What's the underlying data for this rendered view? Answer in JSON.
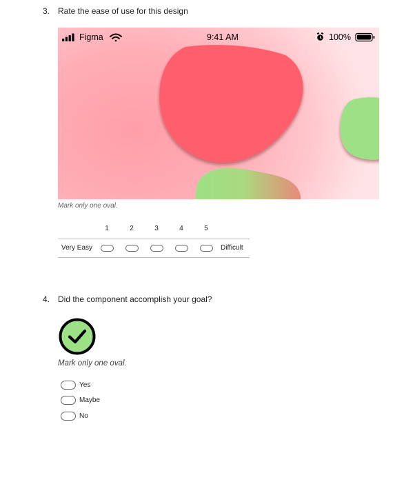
{
  "question3": {
    "number": "3.",
    "title": "Rate the ease of use for this design",
    "image": {
      "status_bar": {
        "carrier": "Figma",
        "time": "9:41 AM",
        "battery": "100%",
        "icons": [
          "signal-bars-icon",
          "wifi-icon",
          "alarm-icon",
          "battery-icon"
        ]
      },
      "colors": {
        "background": "#ffb3ba",
        "red_blob": "#ff5f6d",
        "green_blob": "#9ee085"
      }
    },
    "hint": "Mark only one oval.",
    "scale": {
      "numbers": [
        "1",
        "2",
        "3",
        "4",
        "5"
      ],
      "low_label": "Very Easy",
      "high_label": "Difficult"
    }
  },
  "question4": {
    "number": "4.",
    "title": "Did the component accomplish your goal?",
    "icon": {
      "name": "check-circle-icon",
      "fill": "#9ee085",
      "stroke": "#000000"
    },
    "hint": "Mark only one oval.",
    "options": [
      "Yes",
      "Maybe",
      "No"
    ]
  }
}
